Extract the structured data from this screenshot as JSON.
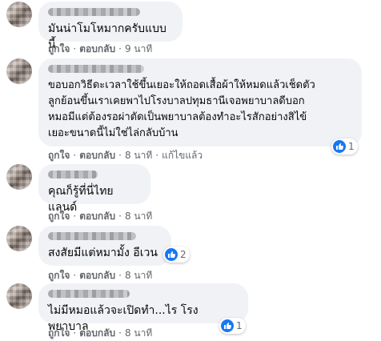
{
  "comments": [
    {
      "text": "มันน่าโมโหมากครับแบบนี้",
      "actions": {
        "like": "ถูกใจ",
        "reply": "ตอบกลับ",
        "time": "9 นาที"
      }
    },
    {
      "text": "ขอบอกวิธีดะเวลาใช้ขึ้นเยอะให้ถอดเสื้อผ้าให้หมดแล้วเช็ดตัว\nลูกย้อนขึ้นเราเคยพาไปโรงบาลปทุมธานีเจอพยาบาลดีบอก\nหมอมีแต่ต้องรอผ่าตัดเป็นพยาบาลต้องทำอะไรสักอย่างสิไข้\nเยอะขนาดนี้ไม่ใช่ไล่กลับบ้าน",
      "actions": {
        "like": "ถูกใจ",
        "reply": "ตอบกลับ",
        "time": "8 นาที",
        "edited": "แก้ไขแล้ว"
      },
      "reaction_count": "1"
    },
    {
      "text": "คุณก็รู้ที่นี่ไทยแลนด์",
      "actions": {
        "like": "ถูกใจ",
        "reply": "ตอบกลับ",
        "time": "8 นาที"
      }
    },
    {
      "text": "สงสัยมีแต่หมามั้ง อีเวน",
      "actions": {
        "like": "ถูกใจ",
        "reply": "ตอบกลับ",
        "time": "8 นาที"
      },
      "reaction_count": "2"
    },
    {
      "text": "ไม่มีหมอแล้วจะเปิดทำ...ไร โรงพยาบาล",
      "actions": {
        "like": "ถูกใจ",
        "reply": "ตอบกลับ",
        "time": "8 นาที"
      },
      "reaction_count": "1"
    }
  ],
  "colors": {
    "bubble": "#f0f2f5",
    "like_blue": "#1877f2",
    "meta_gray": "#65676b"
  },
  "icons": {
    "reaction": "like-thumb-icon"
  }
}
